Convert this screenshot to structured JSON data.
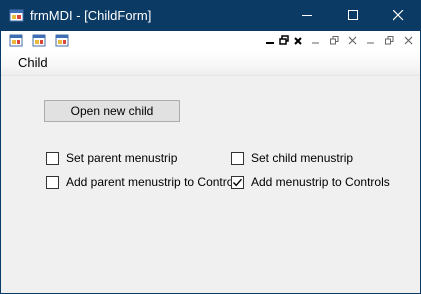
{
  "window": {
    "title": "frmMDI - [ChildForm]"
  },
  "mdi_bar": {
    "icons": [
      "app-icon",
      "app-icon",
      "app-icon"
    ],
    "controls": [
      "minimize",
      "restore",
      "close",
      "minimize",
      "restore",
      "close",
      "minimize",
      "restore",
      "close"
    ]
  },
  "menu": {
    "items": [
      {
        "label": "Child"
      }
    ]
  },
  "form": {
    "open_button_label": "Open new child",
    "checkboxes": [
      {
        "label": "Set parent menustrip",
        "checked": false
      },
      {
        "label": "Set child menustrip",
        "checked": false
      },
      {
        "label": "Add parent menustrip to Controls",
        "checked": false
      },
      {
        "label": "Add menustrip to Controls",
        "checked": true
      }
    ]
  },
  "colors": {
    "titlebar": "#0b3a64",
    "client": "#f0f0f0",
    "button": "#e1e1e1"
  }
}
